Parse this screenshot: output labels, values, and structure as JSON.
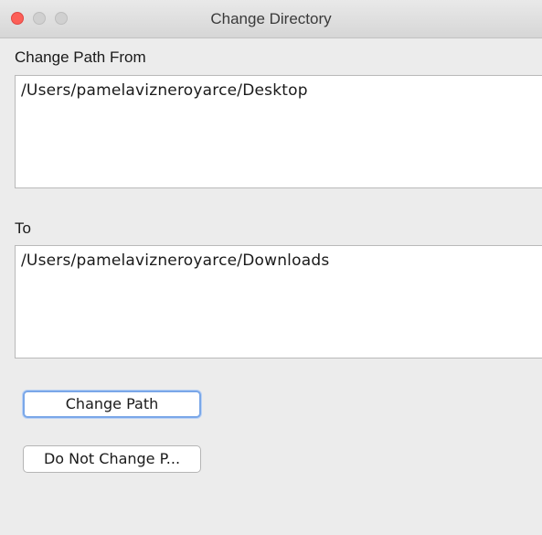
{
  "window": {
    "title": "Change Directory"
  },
  "from": {
    "label": "Change Path From",
    "value": "/Users/pamelavizneroyarce/Desktop"
  },
  "to": {
    "label": "To",
    "value": "/Users/pamelavizneroyarce/Downloads"
  },
  "buttons": {
    "change_path": "Change Path",
    "do_not_change": "Do Not Change P..."
  },
  "colors": {
    "close_button": "#fc5f57",
    "focus_ring": "#7aa7e8",
    "window_bg": "#ececec"
  },
  "icons": {
    "close": "close-icon",
    "minimize": "minimize-icon",
    "zoom": "zoom-icon"
  }
}
